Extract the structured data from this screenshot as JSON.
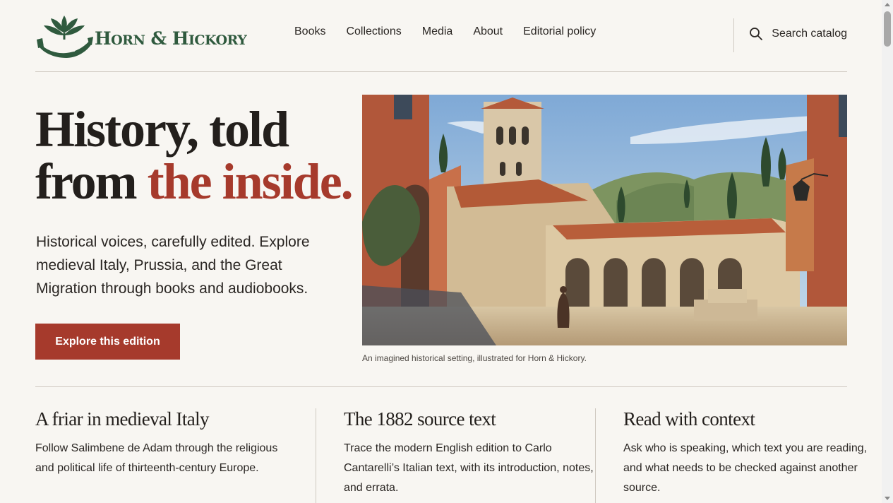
{
  "brand": {
    "name_parts": [
      "H",
      "ORN",
      " & ",
      "H",
      "ICKORY"
    ],
    "logo_icon": "leaf-horn-logo-icon",
    "colors": {
      "green": "#2f5a3e",
      "accent": "#a63a2c"
    }
  },
  "nav": {
    "items": [
      {
        "label": "Books"
      },
      {
        "label": "Collections"
      },
      {
        "label": "Media"
      },
      {
        "label": "About"
      },
      {
        "label": "Editorial policy"
      }
    ],
    "search_label": "Search catalog",
    "search_icon": "search-icon"
  },
  "hero": {
    "title_line1": "History, told",
    "title_line2_plain": "from ",
    "title_line2_accent": "the inside.",
    "subtitle": "Historical voices, carefully edited. Explore medieval Italy, Prussia, and the Great Migration through books and audiobooks.",
    "cta_label": "Explore this edition",
    "image_caption": "An imagined historical setting, illustrated for Horn & Hickory."
  },
  "features": [
    {
      "title": "A friar in medieval Italy",
      "body": "Follow Salimbene de Adam through the religious and political life of thirteenth-century Europe."
    },
    {
      "title": "The 1882 source text",
      "body": "Trace the modern English edition to Carlo Cantarelli’s Italian text, with its introduction, notes, and errata."
    },
    {
      "title": "Read with context",
      "body": "Ask who is speaking, which text you are reading, and what needs to be checked against another source."
    }
  ]
}
